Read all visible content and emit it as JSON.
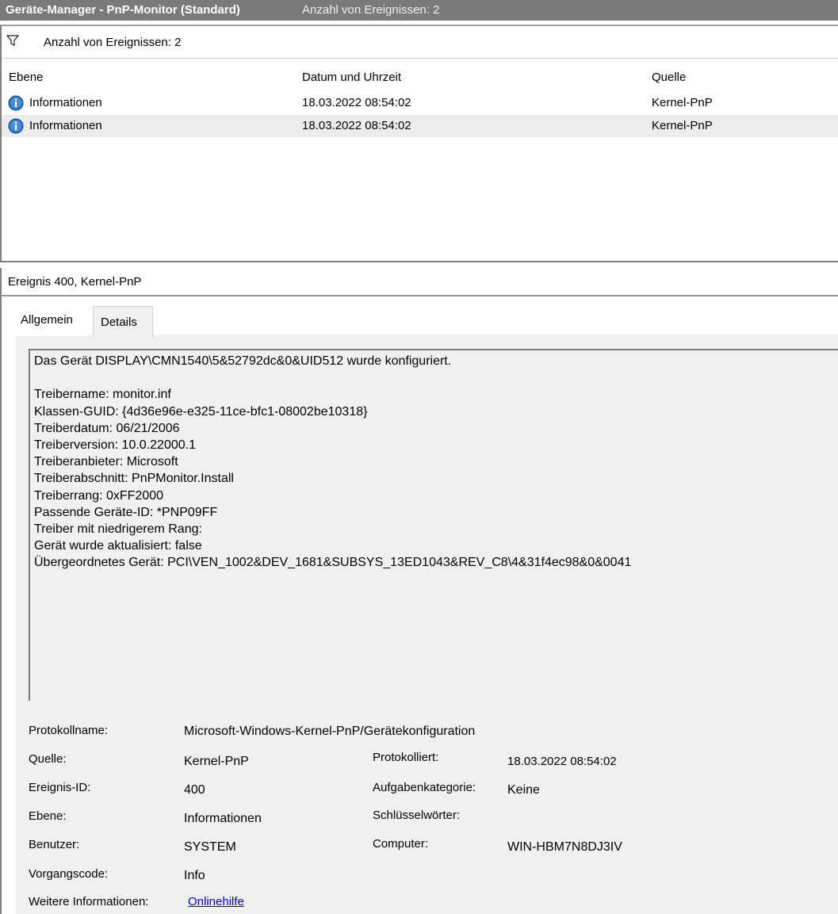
{
  "window": {
    "title": "Geräte-Manager - PnP-Monitor (Standard)",
    "subtitle": "Anzahl von Ereignissen: 2"
  },
  "filter": {
    "text": "Anzahl von Ereignissen: 2",
    "icon": "filter-funnel-icon"
  },
  "grid": {
    "columns": [
      "Ebene",
      "Datum und Uhrzeit",
      "Quelle"
    ],
    "rows": [
      {
        "ebene": "Informationen",
        "datum": "18.03.2022 08:54:02",
        "quelle": "Kernel-PnP",
        "icon": "info-icon"
      },
      {
        "ebene": "Informationen",
        "datum": "18.03.2022 08:54:02",
        "quelle": "Kernel-PnP",
        "icon": "info-icon",
        "selected": true
      }
    ]
  },
  "detail": {
    "title": "Ereignis 400, Kernel-PnP",
    "tabs": [
      "Allgemein",
      "Details"
    ],
    "active_tab": "Allgemein",
    "message": "Das Gerät DISPLAY\\CMN1540\\5&52792dc&0&UID512 wurde konfiguriert.\n\nTreibername: monitor.inf\nKlassen-GUID: {4d36e96e-e325-11ce-bfc1-08002be10318}\nTreiberdatum: 06/21/2006\nTreiberversion: 10.0.22000.1\nTreiberanbieter: Microsoft\nTreiberabschnitt: PnPMonitor.Install\nTreiberrang: 0xFF2000\nPassende Geräte-ID: *PNP09FF\nTreiber mit niedrigerem Rang:\nGerät wurde aktualisiert: false\nÜbergeordnetes Gerät: PCI\\VEN_1002&DEV_1681&SUBSYS_13ED1043&REV_C8\\4&31f4ec98&0&0041",
    "properties": {
      "protokollname_label": "Protokollname:",
      "protokollname": "Microsoft-Windows-Kernel-PnP/Gerätekonfiguration",
      "quelle_label": "Quelle:",
      "quelle": "Kernel-PnP",
      "protokolliert_label": "Protokolliert:",
      "protokolliert": "18.03.2022 08:54:02",
      "ereignis_id_label": "Ereignis-ID:",
      "ereignis_id": "400",
      "aufgabenkategorie_label": "Aufgabenkategorie:",
      "aufgabenkategorie": "Keine",
      "ebene_label": "Ebene:",
      "ebene": "Informationen",
      "schluesselwoerter_label": "Schlüsselwörter:",
      "schluesselwoerter": "",
      "benutzer_label": "Benutzer:",
      "benutzer": "SYSTEM",
      "computer_label": "Computer:",
      "computer": "WIN-HBM7N8DJ3IV",
      "vorgangscode_label": "Vorgangscode:",
      "vorgangscode": "Info",
      "weitere_label": "Weitere Informationen:",
      "weitere_link": "Onlinehilfe"
    }
  },
  "colors": {
    "titlebar": "#7a7a7a",
    "selected_row": "#ececec",
    "panel_bg": "#f0f0f0",
    "link": "#0000ee",
    "info_icon": "#1e73d2"
  }
}
